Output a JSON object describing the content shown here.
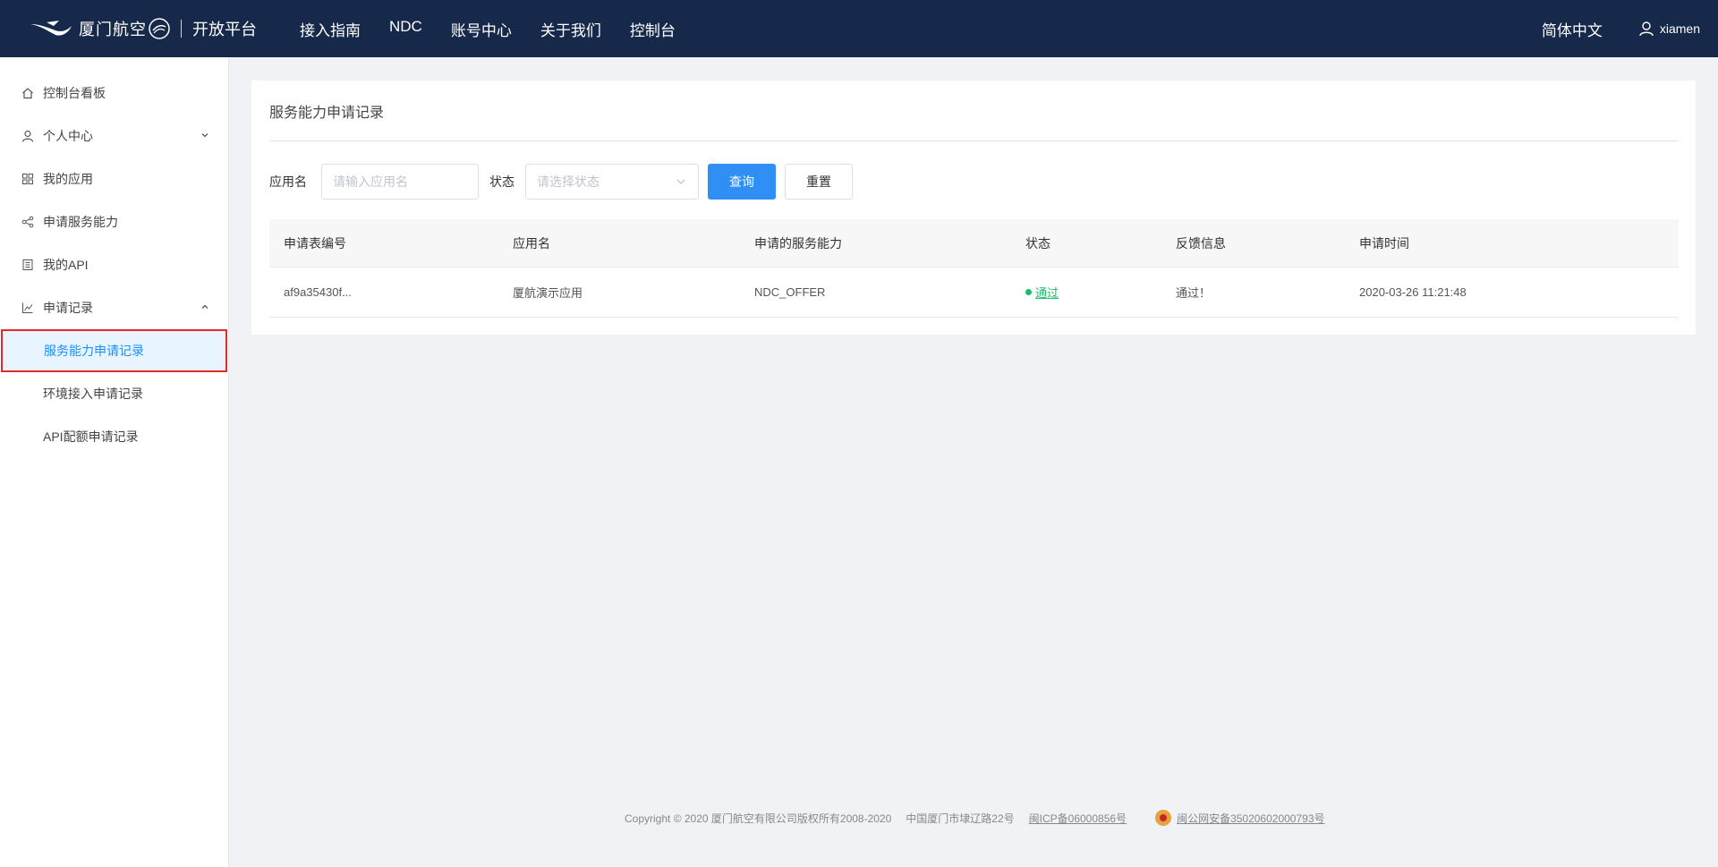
{
  "header": {
    "logo_text": "厦门航空",
    "platform": "开放平台",
    "nav": [
      "接入指南",
      "NDC",
      "账号中心",
      "关于我们",
      "控制台"
    ],
    "language": "简体中文",
    "username": "xiamen"
  },
  "sidebar": {
    "items": [
      {
        "label": "控制台看板",
        "icon": "home-icon"
      },
      {
        "label": "个人中心",
        "icon": "user-icon",
        "caret": "down"
      },
      {
        "label": "我的应用",
        "icon": "grid-icon"
      },
      {
        "label": "申请服务能力",
        "icon": "share-icon"
      },
      {
        "label": "我的API",
        "icon": "book-icon"
      },
      {
        "label": "申请记录",
        "icon": "chart-icon",
        "caret": "up"
      }
    ],
    "submenu": [
      "服务能力申请记录",
      "环境接入申请记录",
      "API配额申请记录"
    ]
  },
  "main": {
    "title": "服务能力申请记录",
    "filter": {
      "app_label": "应用名",
      "app_placeholder": "请输入应用名",
      "status_label": "状态",
      "status_placeholder": "请选择状态",
      "query_button": "查询",
      "reset_button": "重置"
    },
    "table": {
      "headers": [
        "申请表编号",
        "应用名",
        "申请的服务能力",
        "状态",
        "反馈信息",
        "申请时间"
      ],
      "rows": [
        {
          "id": "af9a35430f...",
          "app": "厦航演示应用",
          "capability": "NDC_OFFER",
          "status": "通过",
          "feedback": "通过！",
          "time": "2020-03-26 11:21:48"
        }
      ]
    }
  },
  "footer": {
    "copyright": "Copyright © 2020 厦门航空有限公司版权所有2008-2020",
    "address": "中国厦门市埭辽路22号",
    "icp": "闽ICP备06000856号",
    "police": "闽公网安备35020602000793号"
  },
  "colors": {
    "topbar": "#17294a",
    "primary": "#2f8ff5",
    "active_bg": "#e8f4ff",
    "active_text": "#1890ff",
    "highlight_border": "#e62828",
    "status_green": "#19be6b"
  }
}
